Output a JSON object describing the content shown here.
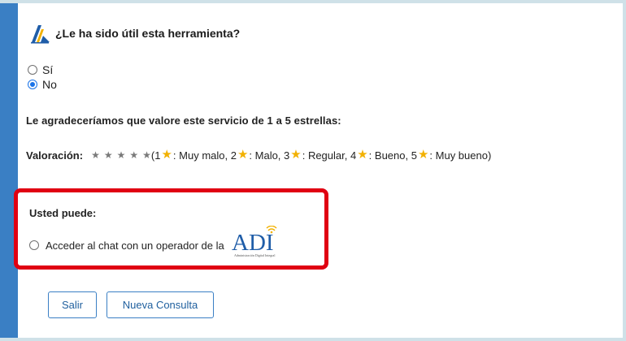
{
  "survey": {
    "question": "¿Le ha sido útil esta herramienta?",
    "options": [
      {
        "label": "Sí",
        "checked": false
      },
      {
        "label": "No",
        "checked": true
      }
    ]
  },
  "rating": {
    "prompt": "Le agradeceríamos que valore este servicio de 1 a 5 estrellas:",
    "label": "Valoración:",
    "star_count": 5,
    "legend_open": "(1",
    "legend_items": [
      ": Muy malo, 2",
      ": Malo, 3",
      ": Regular, 4",
      ": Bueno, 5",
      ": Muy bueno)"
    ]
  },
  "options_box": {
    "title": "Usted puede:",
    "chat_label": "Acceder al chat con un operador de la",
    "logo_text": "ADI",
    "logo_caption": "Administración Digital Integral"
  },
  "buttons": {
    "exit": "Salir",
    "new_query": "Nueva Consulta"
  },
  "colors": {
    "frame_accent": "#3a7fc4",
    "highlight": "#e00012",
    "star_gold": "#f2b100",
    "button_text": "#1f5f9e"
  }
}
